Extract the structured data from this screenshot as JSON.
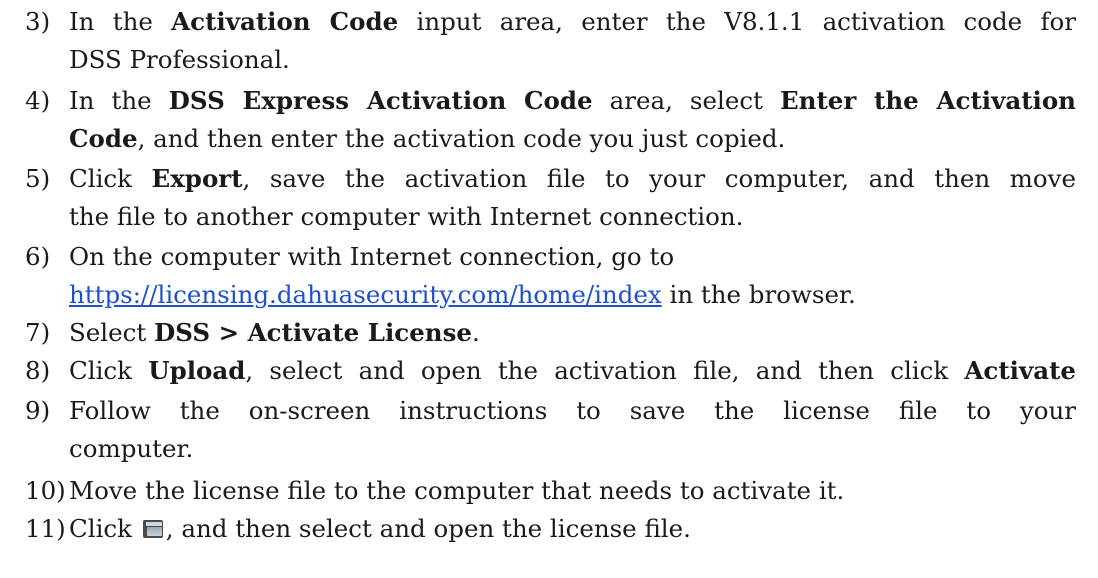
{
  "steps": [
    {
      "num": "3)",
      "lines": [
        [
          {
            "t": "In the "
          },
          {
            "t": "Activation Code",
            "b": true
          },
          {
            "t": " input area, enter the V8.1.1 activation code for"
          }
        ],
        [
          {
            "t": "DSS Professional."
          }
        ]
      ]
    },
    {
      "num": "4)",
      "lines": [
        [
          {
            "t": "In the "
          },
          {
            "t": "DSS Express Activation Code",
            "b": true
          },
          {
            "t": " area, select "
          },
          {
            "t": "Enter the Activation",
            "b": true
          }
        ],
        [
          {
            "t": "Code",
            "b": true
          },
          {
            "t": ", and then enter the activation code you just copied."
          }
        ]
      ]
    },
    {
      "num": "5)",
      "lines": [
        [
          {
            "t": "Click "
          },
          {
            "t": "Export",
            "b": true
          },
          {
            "t": ", save the activation file to your computer, and then move"
          }
        ],
        [
          {
            "t": "the file to another computer with Internet connection."
          }
        ]
      ]
    },
    {
      "num": "6)",
      "lines": [
        [
          {
            "t": "On the computer with Internet connection, go to"
          }
        ],
        [
          {
            "t": "https://licensing.dahuasecurity.com/home/index",
            "link": true
          },
          {
            "t": " in the browser."
          }
        ]
      ]
    },
    {
      "num": "7)",
      "lines": [
        [
          {
            "t": "Select "
          },
          {
            "t": "DSS > Activate License",
            "b": true
          },
          {
            "t": "."
          }
        ]
      ]
    },
    {
      "num": "8)",
      "lines": [
        [
          {
            "t": "Click "
          },
          {
            "t": "Upload",
            "b": true
          },
          {
            "t": ", select and open the activation file, and then click "
          },
          {
            "t": "Activate",
            "b": true
          }
        ]
      ]
    },
    {
      "num": "9)",
      "lines": [
        [
          {
            "t": "Follow the on-screen instructions to save the license file to your"
          }
        ],
        [
          {
            "t": "computer."
          }
        ]
      ]
    },
    {
      "num": "10)",
      "lines": [
        [
          {
            "t": "Move the license file to the computer that needs to activate it."
          }
        ]
      ]
    },
    {
      "num": "11)",
      "lines": [
        [
          {
            "t": "Click "
          },
          {
            "icon": "open-folder-icon"
          },
          {
            "t": ", and then select and open the license file."
          }
        ]
      ]
    }
  ]
}
